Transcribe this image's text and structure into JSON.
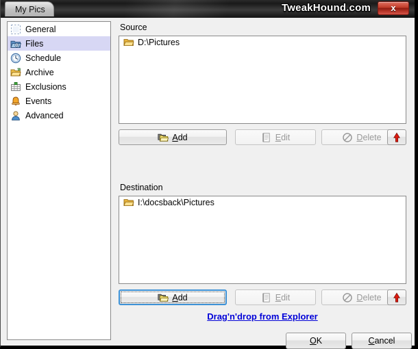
{
  "window": {
    "title": "My Pics",
    "watermark": "TweakHound.com",
    "close_label": "x",
    "close_icon": "close-icon"
  },
  "sidebar": {
    "items": [
      {
        "label": "General",
        "icon": "general-icon",
        "selected": false
      },
      {
        "label": "Files",
        "icon": "files-icon",
        "selected": true
      },
      {
        "label": "Schedule",
        "icon": "schedule-icon",
        "selected": false
      },
      {
        "label": "Archive",
        "icon": "archive-icon",
        "selected": false
      },
      {
        "label": "Exclusions",
        "icon": "exclusions-icon",
        "selected": false
      },
      {
        "label": "Events",
        "icon": "events-icon",
        "selected": false
      },
      {
        "label": "Advanced",
        "icon": "advanced-icon",
        "selected": false
      }
    ]
  },
  "source": {
    "label": "Source",
    "items": [
      {
        "path": "D:\\Pictures",
        "icon": "folder-icon"
      }
    ],
    "buttons": {
      "add": "Add",
      "add_accel": "A",
      "edit": "Edit",
      "edit_accel": "E",
      "delete": "Delete",
      "delete_accel": "D",
      "move_up_icon": "red-up-arrow-icon"
    }
  },
  "destination": {
    "label": "Destination",
    "items": [
      {
        "path": "I:\\docsback\\Pictures",
        "icon": "folder-icon"
      }
    ],
    "buttons": {
      "add": "Add",
      "add_accel": "A",
      "edit": "Edit",
      "edit_accel": "E",
      "delete": "Delete",
      "delete_accel": "D",
      "move_up_icon": "red-up-arrow-icon"
    }
  },
  "hint": {
    "link_text": "Drag'n'drop from Explorer"
  },
  "footer": {
    "ok": "OK",
    "ok_accel": "O",
    "cancel": "Cancel",
    "cancel_accel": "C"
  },
  "colors": {
    "selection": "#d7d7f4",
    "link": "#0000d8",
    "focus_border": "#3c91d6",
    "close_button": "#c03a28",
    "accent_arrow": "#e01b10"
  }
}
